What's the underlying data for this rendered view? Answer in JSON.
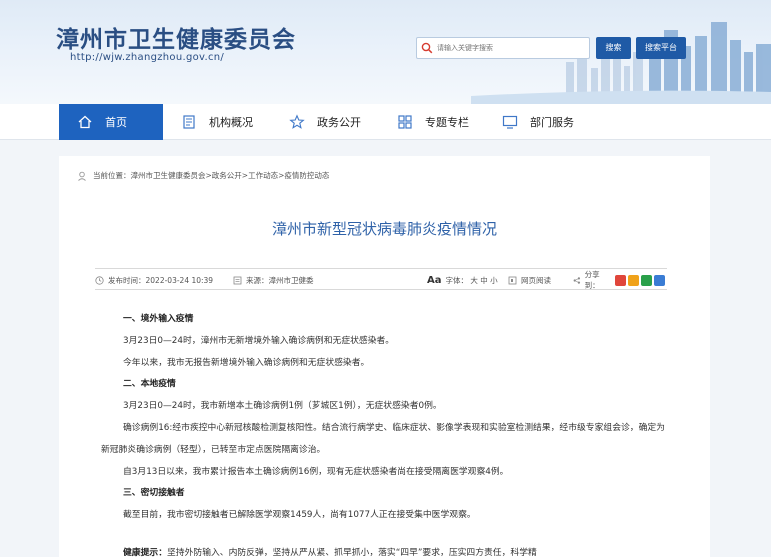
{
  "header": {
    "site_title": "漳州市卫生健康委员会",
    "site_url": "http://wjw.zhangzhou.gov.cn/",
    "search_placeholder": "请输入关键字搜索",
    "search_button": "搜索",
    "platform_button": "搜索平台"
  },
  "nav": {
    "items": [
      {
        "label": "首页",
        "icon": "home-icon"
      },
      {
        "label": "机构概况",
        "icon": "document-icon"
      },
      {
        "label": "政务公开",
        "icon": "star-icon"
      },
      {
        "label": "专题专栏",
        "icon": "grid-icon"
      },
      {
        "label": "部门服务",
        "icon": "monitor-icon"
      }
    ]
  },
  "breadcrumb": "当前位置：漳州市卫生健康委员会>政务公开>工作动态>疫情防控动态",
  "article": {
    "title": "漳州市新型冠状病毒肺炎疫情情况",
    "publish_time": "发布时间：2022-03-24 10:39",
    "source": "来源：漳州市卫健委",
    "font_size": "字体：  大  中  小",
    "font_icon": "Aa",
    "web_reader": "网页阅读",
    "share": "分享到：",
    "share_colors": [
      "#e0463b",
      "#f0a21a",
      "#2aa04a",
      "#3a7cd4"
    ],
    "paragraphs": [
      {
        "type": "h",
        "text": "一、境外输入疫情"
      },
      {
        "type": "p",
        "text": "3月23日0—24时，漳州市无新增境外输入确诊病例和无症状感染者。"
      },
      {
        "type": "p",
        "text": "今年以来，我市无报告新增境外输入确诊病例和无症状感染者。"
      },
      {
        "type": "h",
        "text": "二、本地疫情"
      },
      {
        "type": "p",
        "text": "3月23日0—24时，我市新增本土确诊病例1例（芗城区1例），无症状感染者0例。"
      },
      {
        "type": "p",
        "text": "确诊病例16:经市疾控中心新冠核酸检测复核阳性。结合流行病学史、临床症状、影像学表现和实验室检测结果，经市级专家组会诊，确定为新冠肺炎确诊病例（轻型），已转至市定点医院隔离诊治。"
      },
      {
        "type": "p",
        "text": "自3月13日以来，我市累计报告本土确诊病例16例，现有无症状感染者尚在接受隔离医学观察4例。"
      },
      {
        "type": "h",
        "text": "三、密切接触者"
      },
      {
        "type": "p",
        "text": "截至目前，我市密切接触者已解除医学观察1459人，尚有1077人正在接受集中医学观察。"
      }
    ],
    "tip_label": "健康提示：",
    "tip_text": "坚持外防输入、内防反弹，坚持从严从紧、抓早抓小，落实“四早”要求，压实四方责任，科学精"
  }
}
